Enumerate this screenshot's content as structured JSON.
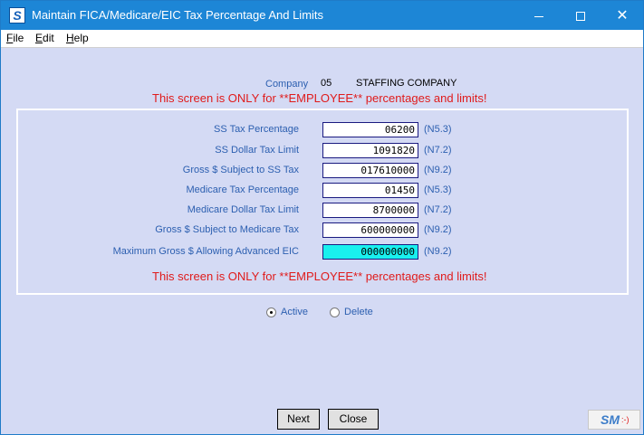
{
  "window": {
    "title": "Maintain FICA/Medicare/EIC Tax Percentage And Limits",
    "app_icon_letter": "S"
  },
  "menu": {
    "file": {
      "underline": "F",
      "rest": "ile"
    },
    "edit": {
      "underline": "E",
      "rest": "dit"
    },
    "help": {
      "underline": "H",
      "rest": "elp"
    }
  },
  "company": {
    "label": "Company",
    "code": "05",
    "name": "STAFFING COMPANY"
  },
  "warning_text": "This screen is ONLY for **EMPLOYEE** percentages and limits!",
  "fields": [
    {
      "label": "SS Tax Percentage",
      "value": "06200",
      "format": "(N5.3)"
    },
    {
      "label": "SS Dollar Tax Limit",
      "value": "1091820",
      "format": "(N7.2)"
    },
    {
      "label": "Gross $ Subject to SS Tax",
      "value": "017610000",
      "format": "(N9.2)"
    },
    {
      "label": "Medicare Tax Percentage",
      "value": "01450",
      "format": "(N5.3)"
    },
    {
      "label": "Medicare Dollar Tax Limit",
      "value": "8700000",
      "format": "(N7.2)"
    },
    {
      "label": "Gross $ Subject to Medicare Tax",
      "value": "600000000",
      "format": "(N9.2)"
    },
    {
      "label": "Maximum Gross $ Allowing Advanced EIC",
      "value": "000000000",
      "format": "(N9.2)"
    }
  ],
  "status": {
    "active_label": "Active",
    "delete_label": "Delete",
    "selected": "Active"
  },
  "buttons": {
    "next": "Next",
    "close": "Close"
  },
  "logo": {
    "text": "SM",
    "smile": ":-)"
  },
  "colors": {
    "title_bar": "#1d86d6",
    "background": "#d4daf4",
    "label_blue": "#2c5fb0",
    "warning_red": "#e01b1b",
    "focused_input": "#19f0ee"
  }
}
